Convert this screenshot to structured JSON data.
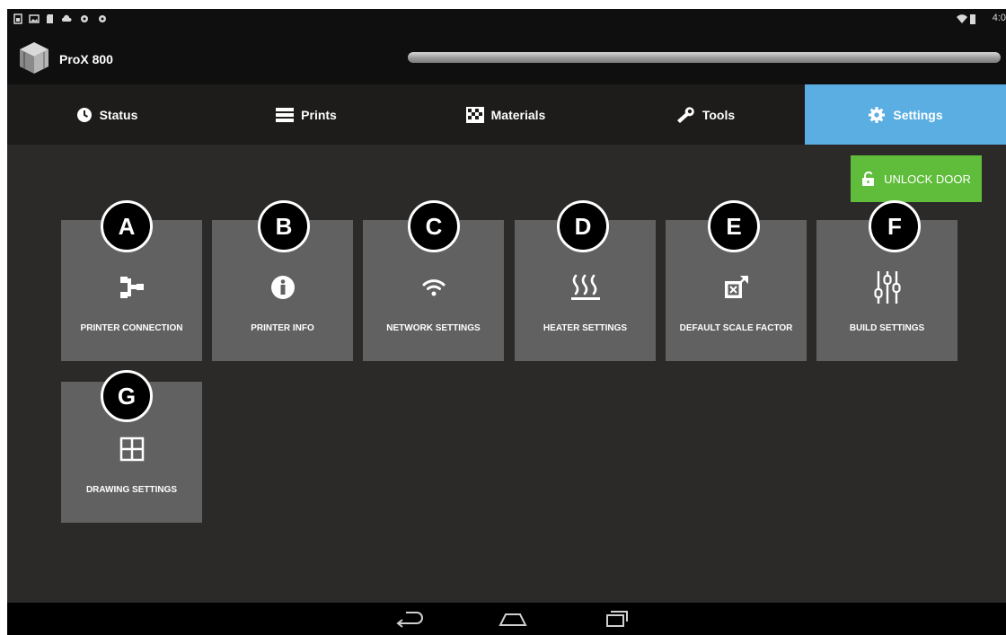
{
  "app": {
    "title": "ProX 800",
    "progress": 1.0
  },
  "status_bar": {
    "time": "4:0",
    "left_icons": [
      "sim-icon",
      "image-icon",
      "sd-card-icon",
      "cloud-icon",
      "gear-icon",
      "gear-icon"
    ],
    "right_icons": [
      "wifi-icon",
      "battery-icon"
    ]
  },
  "tabs": [
    {
      "label": "Status",
      "icon": "clock-icon",
      "active": false
    },
    {
      "label": "Prints",
      "icon": "list-icon",
      "active": false
    },
    {
      "label": "Materials",
      "icon": "checker-icon",
      "active": false
    },
    {
      "label": "Tools",
      "icon": "wrench-icon",
      "active": false
    },
    {
      "label": "Settings",
      "icon": "gear-icon",
      "active": true
    }
  ],
  "unlock": {
    "label": "UNLOCK DOOR"
  },
  "tiles": [
    {
      "marker": "A",
      "label": "PRINTER CONNECTION",
      "icon": "connection-icon"
    },
    {
      "marker": "B",
      "label": "PRINTER INFO",
      "icon": "info-icon"
    },
    {
      "marker": "C",
      "label": "NETWORK SETTINGS",
      "icon": "wifi-icon"
    },
    {
      "marker": "D",
      "label": "HEATER SETTINGS",
      "icon": "heater-icon"
    },
    {
      "marker": "E",
      "label": "DEFAULT SCALE FACTOR",
      "icon": "scale-icon"
    },
    {
      "marker": "F",
      "label": "BUILD SETTINGS",
      "icon": "sliders-icon"
    },
    {
      "marker": "G",
      "label": "DRAWING SETTINGS",
      "icon": "grid-icon"
    }
  ],
  "nav": [
    "back-icon",
    "home-icon",
    "recents-icon"
  ],
  "colors": {
    "accent": "#5aaee2",
    "unlock": "#5fbd3b",
    "tile": "#616161",
    "background": "#2b2a28"
  }
}
